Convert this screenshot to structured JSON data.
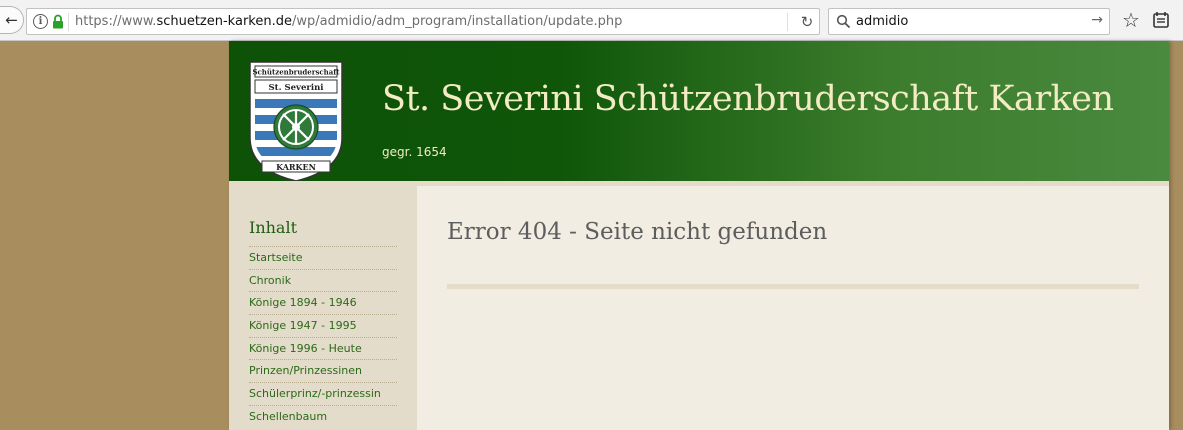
{
  "browser": {
    "url_prefix": "https://www.",
    "url_host": "schuetzen-karken.de",
    "url_path": "/wp/admidio/adm_program/installation/update.php",
    "search_value": "admidio"
  },
  "site": {
    "title": "St. Severini Schützenbruderschaft Karken",
    "subtitle": "gegr. 1654",
    "crest_text": {
      "top": "Schützenbruderschaft",
      "name": "St. Severini",
      "bottom": "KARKEN"
    }
  },
  "sidebar": {
    "heading": "Inhalt",
    "items": [
      "Startseite",
      "Chronik",
      "Könige 1894 - 1946",
      "Könige 1947 - 1995",
      "Könige 1996 - Heute",
      "Prinzen/Prinzessinen",
      "Schülerprinz/-prinzessin",
      "Schellenbaum"
    ]
  },
  "content": {
    "title": "Error 404 - Seite nicht gefunden"
  },
  "colors": {
    "header_green": "#0e5208",
    "title_cream": "#f2ebc4",
    "link_green": "#2a6a17",
    "desktop_tan": "#a88e5e"
  }
}
